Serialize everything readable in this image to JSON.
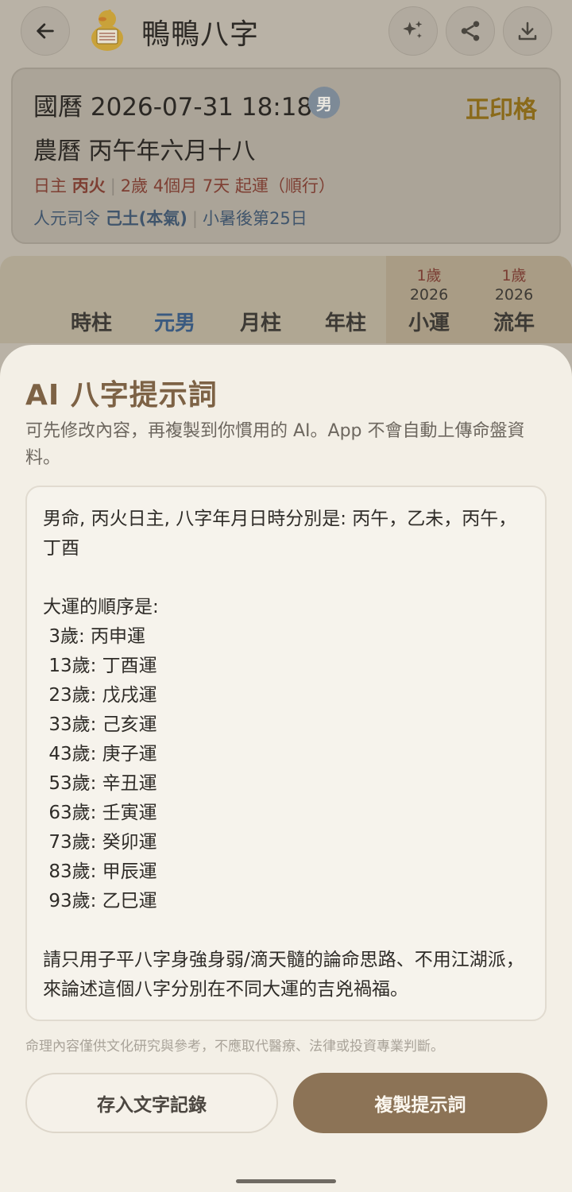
{
  "app": {
    "title": "鴨鴨八字",
    "logo_icon": "duck-logo-icon",
    "actions": [
      "back-arrow-icon",
      "sparkle-icon",
      "share-icon",
      "download-icon"
    ]
  },
  "chart_info": {
    "solar": "國曆 2026-07-31 18:18",
    "gender": "男",
    "pattern": "正印格",
    "lunar": "農曆 丙午年六月十八",
    "day_master_label": "日主",
    "day_master": "丙火",
    "luck_start": "2歲 4個月 7天 起運（順行）",
    "ren_yuan_label": "人元司令",
    "ren_yuan": "己土(本氣)",
    "solar_term": "小暑後第25日"
  },
  "pillars": {
    "columns": [
      "時柱",
      "元男",
      "月柱",
      "年柱"
    ],
    "active_index": 1,
    "luck": [
      {
        "age": "1歲",
        "year": "2026",
        "label": "小運"
      },
      {
        "age": "1歲",
        "year": "2026",
        "label": "流年"
      }
    ]
  },
  "sheet": {
    "title": "AI 八字提示詞",
    "subtitle": "可先修改內容，再複製到你慣用的 AI。App 不會自動上傳命盤資料。",
    "prompt": "男命, 丙火日主, 八字年月日時分別是: 丙午，乙未，丙午，丁酉\n\n大運的順序是:\n 3歲: 丙申運\n 13歲: 丁酉運\n 23歲: 戊戌運\n 33歲: 己亥運\n 43歲: 庚子運\n 53歲: 辛丑運\n 63歲: 壬寅運\n 73歲: 癸卯運\n 83歲: 甲辰運\n 93歲: 乙巳運\n\n請只用子平八字身強身弱/滴天髓的論命思路、不用江湖派，來論述這個八字分別在不同大運的吉兇禍福。",
    "disclaimer": "命理內容僅供文化研究與參考，不應取代醫療、法律或投資專業判斷。",
    "save_button": "存入文字記錄",
    "copy_button": "複製提示詞"
  },
  "colors": {
    "accent": "#8c7356",
    "title": "#7d6245",
    "pattern": "#8a6a1a",
    "active_pillar": "#3a5a80"
  }
}
